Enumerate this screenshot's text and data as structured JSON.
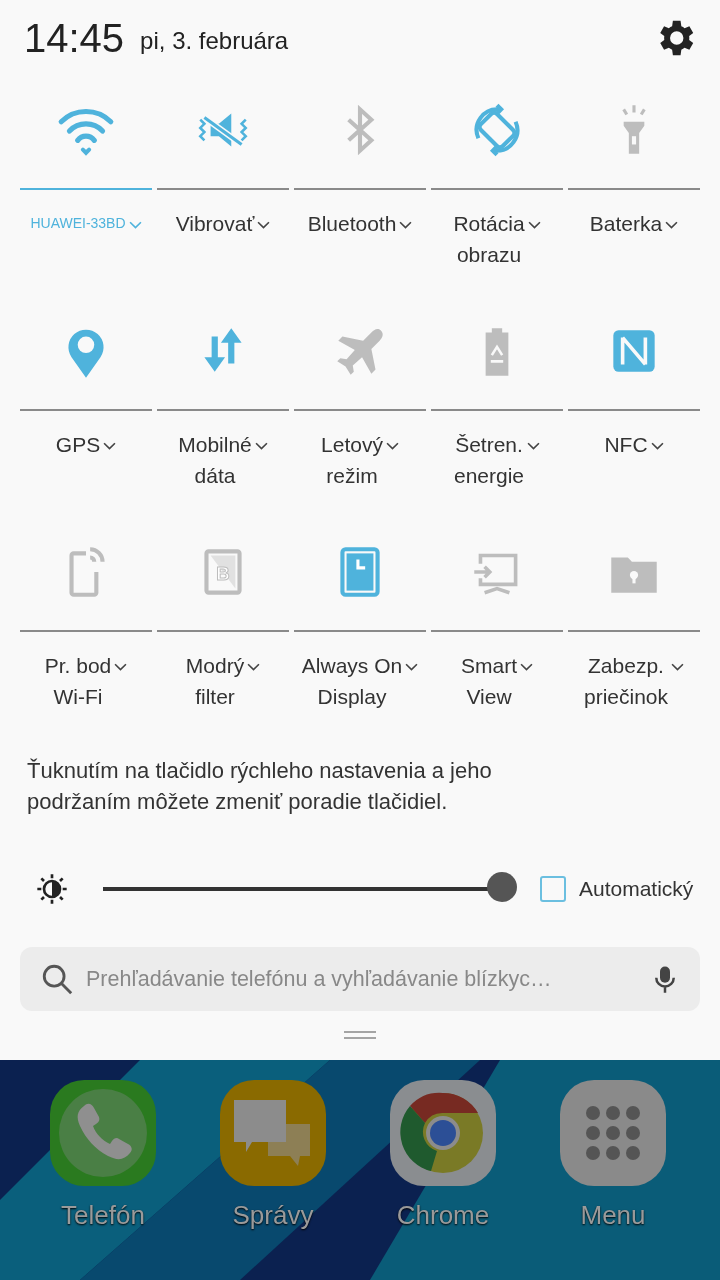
{
  "status_bar": {
    "time": "14:45",
    "date": "pi, 3. februára"
  },
  "tiles": [
    {
      "kind": "wifi",
      "label": "HUAWEI-33BD",
      "on": true,
      "connected": true
    },
    {
      "kind": "vibrate",
      "label": "Vibrovať",
      "on": true
    },
    {
      "kind": "bluetooth",
      "label": "Bluetooth",
      "on": false
    },
    {
      "kind": "rotation",
      "label": "Rotácia\nobrazu",
      "on": true
    },
    {
      "kind": "flashlight",
      "label": "Baterka",
      "on": false
    },
    {
      "kind": "gps",
      "label": "GPS",
      "on": true
    },
    {
      "kind": "data",
      "label": "Mobilné\ndáta",
      "on": true
    },
    {
      "kind": "airplane",
      "label": "Letový\nrežim",
      "on": false
    },
    {
      "kind": "battery",
      "label": "Šetren.\nenergie",
      "on": false
    },
    {
      "kind": "nfc",
      "label": "NFC",
      "on": true
    },
    {
      "kind": "hotspot",
      "label": "Pr. bod\nWi-Fi",
      "on": false
    },
    {
      "kind": "filter",
      "label": "Modrý\nfilter",
      "on": false,
      "glyph": "B"
    },
    {
      "kind": "clock",
      "label": "Always On\nDisplay",
      "on": true
    },
    {
      "kind": "screen",
      "label": "Smart\nView",
      "on": false
    },
    {
      "kind": "folder",
      "label": "Zabezp.\npriečinok",
      "on": false
    }
  ],
  "hint": "Ťuknutím na tlačidlo rýchleho nastavenia a jeho podržaním môžete zmeniť poradie tlačidiel.",
  "brightness": {
    "level": 1.0,
    "auto_label": "Automatický",
    "auto_checked": false
  },
  "search": {
    "placeholder": "Prehľadávanie telefónu a vyhľadávanie blízkyc…"
  },
  "dock": [
    {
      "kind": "phone",
      "label": "Telefón"
    },
    {
      "kind": "messages",
      "label": "Správy"
    },
    {
      "kind": "browser",
      "label": "Chrome"
    },
    {
      "kind": "apps",
      "label": "Menu"
    }
  ]
}
